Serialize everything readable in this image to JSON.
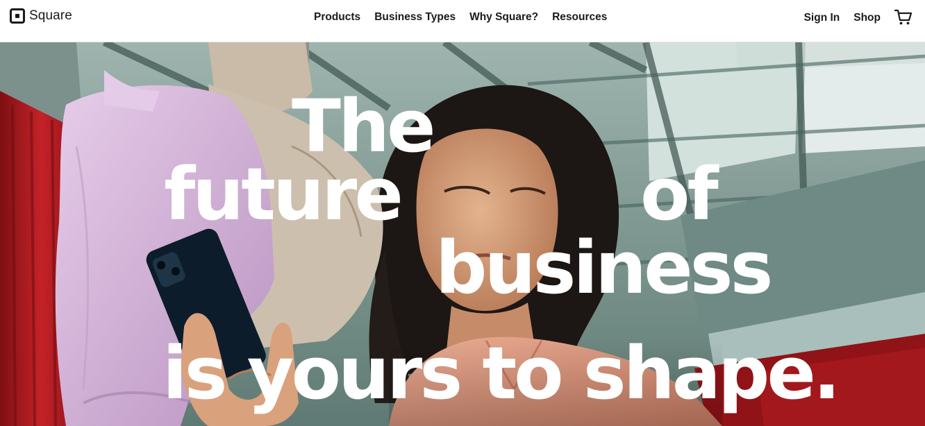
{
  "header": {
    "brand": "Square",
    "nav": [
      "Products",
      "Business Types",
      "Why Square?",
      "Resources"
    ],
    "sign_in": "Sign In",
    "shop": "Shop"
  },
  "hero": {
    "headline": {
      "word1": "The",
      "word2": "future",
      "word3": "of",
      "word4": "business",
      "line4": "is yours to shape."
    }
  },
  "colors": {
    "nav_text": "#1a1a1a",
    "headline": "#ffffff",
    "dress": "#d9b7dd",
    "curtain": "#b51d22",
    "ceiling": "#8fa6a0",
    "shirt": "#e19c83"
  },
  "icons": [
    "square-logo-icon",
    "shopping-cart-icon"
  ]
}
